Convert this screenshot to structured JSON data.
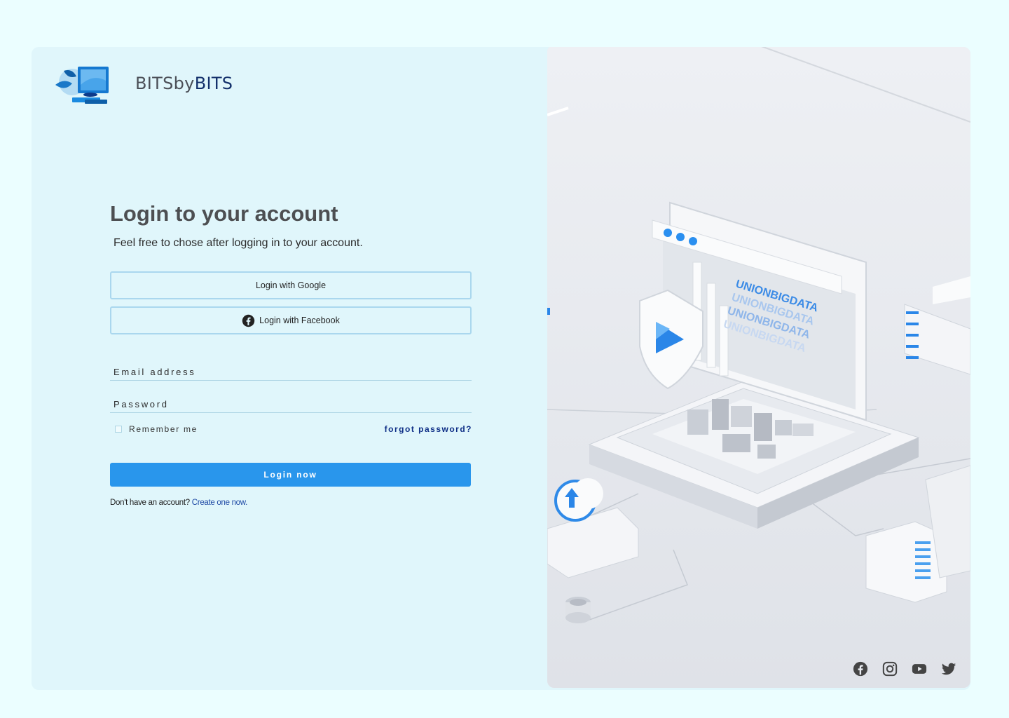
{
  "brand": {
    "part1": "BITSby",
    "part2": "BITS"
  },
  "login": {
    "title": "Login to your account",
    "subtitle": "Feel free to chose after logging  in to your account.",
    "google_label": "Login with Google",
    "facebook_label": "Login with Facebook",
    "email_placeholder": "Email address",
    "password_placeholder": "Password",
    "remember_label": "Remember me",
    "forgot_label": "forgot password?",
    "submit_label": "Login now",
    "signup_text": "Don't have an account?",
    "signup_link": "Create one now."
  },
  "hero": {
    "label_lines": [
      "UNIONBIGDATA",
      "UNIONBIGDATA",
      "UNIONBIGDATA",
      "UNIONBIGDATA"
    ]
  },
  "social": {
    "icons": [
      "facebook-icon",
      "instagram-icon",
      "youtube-icon",
      "twitter-icon"
    ]
  },
  "colors": {
    "page_bg": "#ebfeff",
    "panel_bg": "#e0f6fb",
    "primary": "#2996ec",
    "link": "#0e2e86",
    "brand_dark": "#13306b"
  }
}
